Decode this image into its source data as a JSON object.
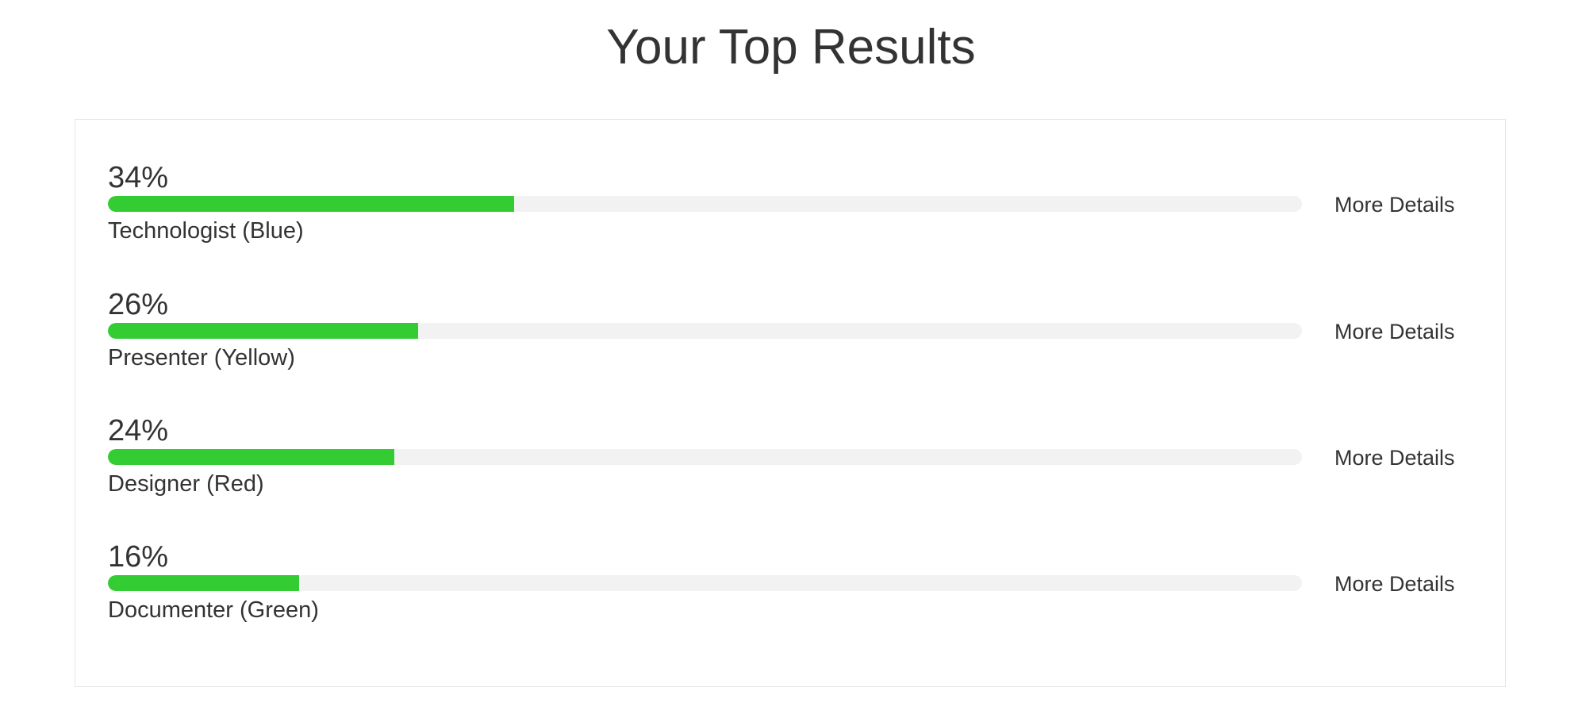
{
  "page": {
    "title": "Your Top Results"
  },
  "colors": {
    "bar_fill": "#33cc33",
    "bar_track": "#f2f2f2",
    "text": "#333333",
    "panel_border": "#e6e6e6"
  },
  "results": [
    {
      "percent_label": "34%",
      "fraction": 0.34,
      "label": "Technologist (Blue)",
      "action_label": "More Details"
    },
    {
      "percent_label": "26%",
      "fraction": 0.26,
      "label": "Presenter (Yellow)",
      "action_label": "More Details"
    },
    {
      "percent_label": "24%",
      "fraction": 0.24,
      "label": "Designer (Red)",
      "action_label": "More Details"
    },
    {
      "percent_label": "16%",
      "fraction": 0.16,
      "label": "Documenter (Green)",
      "action_label": "More Details"
    }
  ]
}
